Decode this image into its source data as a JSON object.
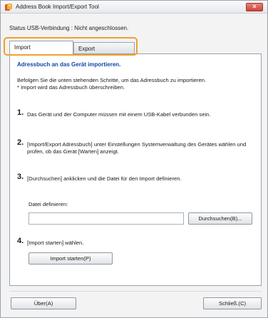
{
  "window": {
    "title": "Address Book Import/Export Tool",
    "close_label": "×"
  },
  "status": {
    "text": "Status USB-Verbindung : Nicht angeschlossen."
  },
  "tabs": [
    {
      "label": "Import",
      "active": true
    },
    {
      "label": "Export",
      "active": false
    }
  ],
  "panel": {
    "heading": "Adressbuch an das Gerät importieren.",
    "intro_line1": "Befolgen Sie die unten stehenden Schritte, um das Adressbuch zu importieren.",
    "intro_line2": "* Import wird das Adressbuch überschreiben.",
    "steps": [
      {
        "num": "1.",
        "text": "Das Gerät und der Computer müssen mit einem USB-Kabel verbunden sein."
      },
      {
        "num": "2.",
        "text": "[Import/Export Adressbuch] unter Einstellungen Systemverwaltung des Gerätes wählen und prüfen, ob das Gerät [Warten] anzeigt."
      },
      {
        "num": "3.",
        "text": "[Durchsuchen] anklicken und die Datei für den Import definieren."
      },
      {
        "num": "4.",
        "text": "[Import starten] wählen."
      }
    ],
    "file_label": "Datei definieren:",
    "file_value": "",
    "browse_label": "Durchsuchen(B)...",
    "import_label": "Import starten(P)"
  },
  "footer": {
    "about_label": "Über(A)",
    "close_label": "Schließ.(C)"
  },
  "colors": {
    "accent": "#0a4aa8",
    "highlight": "#f0a030"
  }
}
